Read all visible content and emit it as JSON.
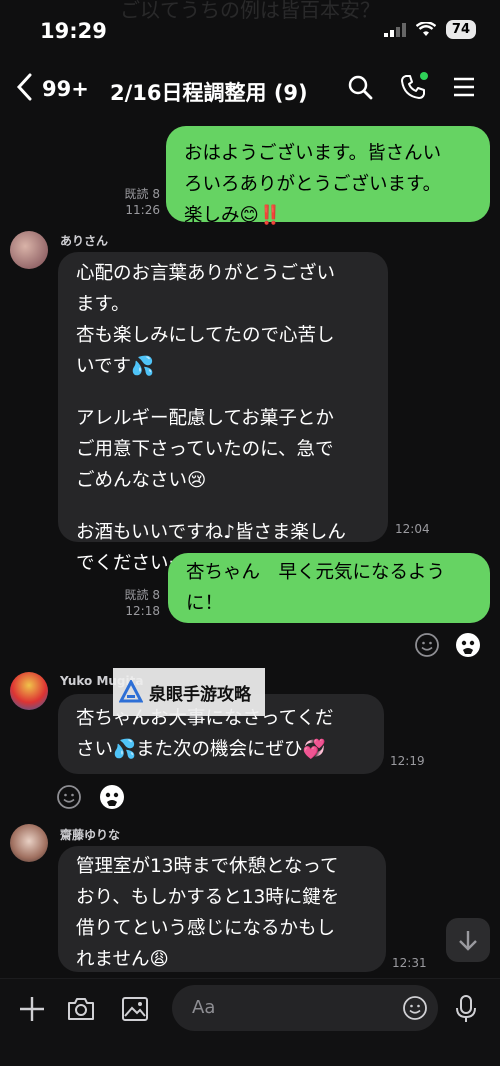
{
  "status_bar": {
    "time": "19:29",
    "battery": "74"
  },
  "header": {
    "back_icon": "chevron-left-icon",
    "unread_count": "99+",
    "title": "2/16日程調整用 (9)"
  },
  "messages": {
    "m1": {
      "lines": [
        "おはようございます。皆さんい",
        "ろいろありがとうございます。",
        "楽しみ😊‼️"
      ],
      "read": "既読 8",
      "time": "11:26"
    },
    "m2": {
      "sender": "ありさん",
      "lines": [
        "心配のお言葉ありがとうござい",
        "ます。",
        "杏も楽しみにしてたので心苦し",
        "いです💦",
        "",
        "アレルギー配慮してお菓子とか",
        "ご用意下さっていたのに、急で",
        "ごめんなさい😢",
        "",
        "お酒もいいですね♪皆さま楽しん",
        "でくださいー！！"
      ],
      "time": "12:04"
    },
    "m3": {
      "lines": [
        "杏ちゃん　早く元気になるよう",
        "に！"
      ],
      "read": "既読 8",
      "time": "12:18"
    },
    "m4": {
      "sender": "Yuko Mugita",
      "lines": [
        "杏ちゃんお大事になさってくだ",
        "さい💦また次の機会にぜひ💞"
      ],
      "time": "12:19"
    },
    "m5": {
      "sender": "齋藤ゆりな",
      "lines": [
        "管理室が13時まで休憩となって",
        "おり、もしかすると13時に鍵を",
        "借りてという感じになるかもし",
        "れません😩"
      ],
      "time": "12:31"
    }
  },
  "watermark": {
    "text": "泉眼手游攻略"
  },
  "input": {
    "placeholder": "Aa"
  },
  "colors": {
    "outgoing_bubble": "#66d363",
    "incoming_bubble": "#262628",
    "background": "#0f0f10",
    "online_dot": "#2fd158"
  }
}
